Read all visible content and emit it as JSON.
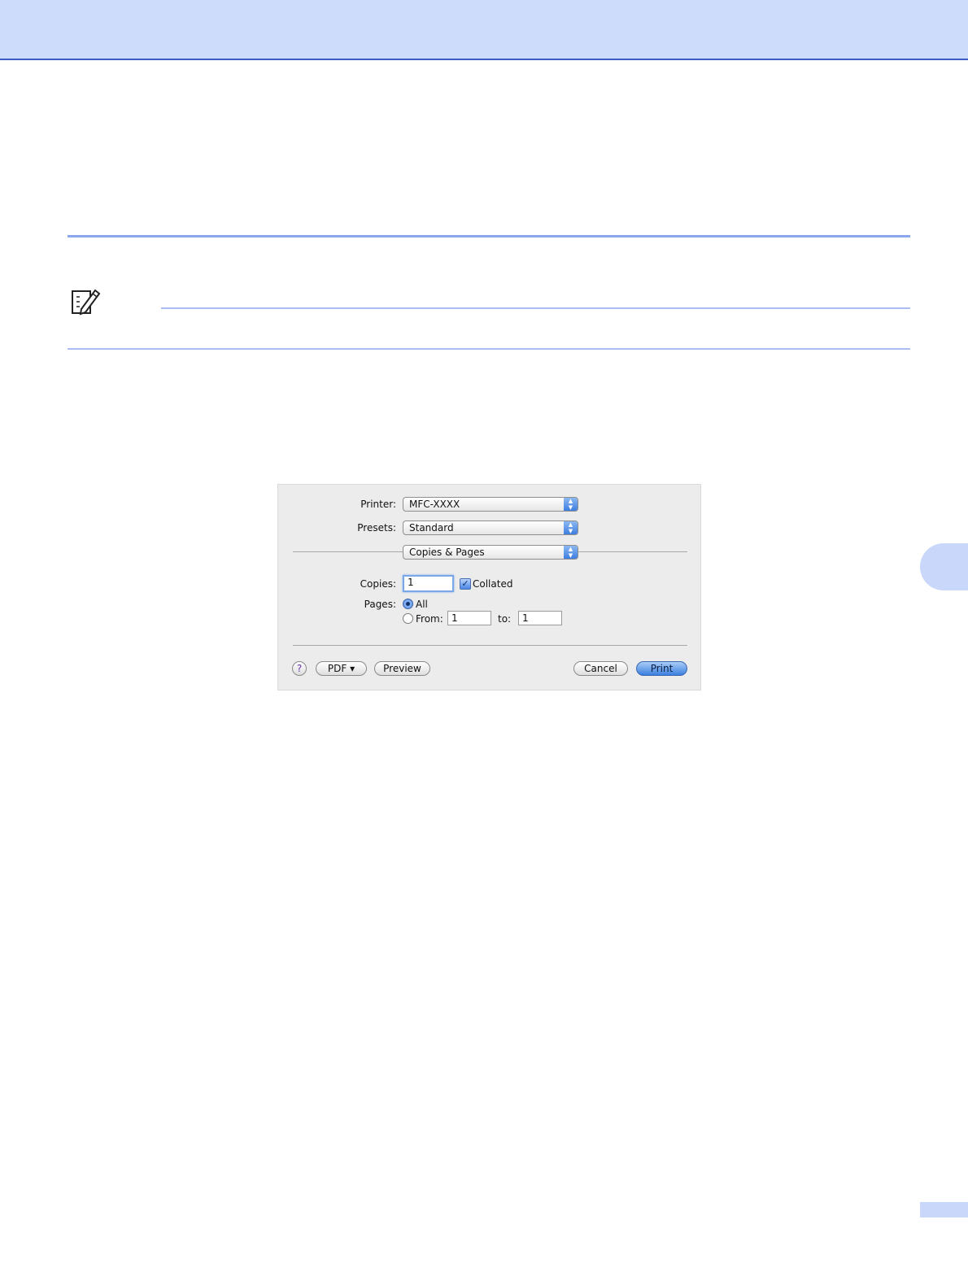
{
  "dialog": {
    "printer": {
      "label": "Printer:",
      "value": "MFC-XXXX"
    },
    "presets": {
      "label": "Presets:",
      "value": "Standard"
    },
    "panel": {
      "value": "Copies & Pages"
    },
    "copies": {
      "label": "Copies:",
      "value": "1",
      "collated_label": "Collated",
      "collated": true
    },
    "pages": {
      "label": "Pages:",
      "all_label": "All",
      "from_label": "From:",
      "from_value": "1",
      "to_label": "to:",
      "to_value": "1",
      "selected": "All"
    },
    "buttons": {
      "help": "?",
      "pdf": "PDF ▾",
      "preview": "Preview",
      "cancel": "Cancel",
      "print": "Print"
    }
  },
  "colors": {
    "header_band": "#cddcfb",
    "accent_rule": "#8aa6ee",
    "default_button": "#3c80e0"
  }
}
